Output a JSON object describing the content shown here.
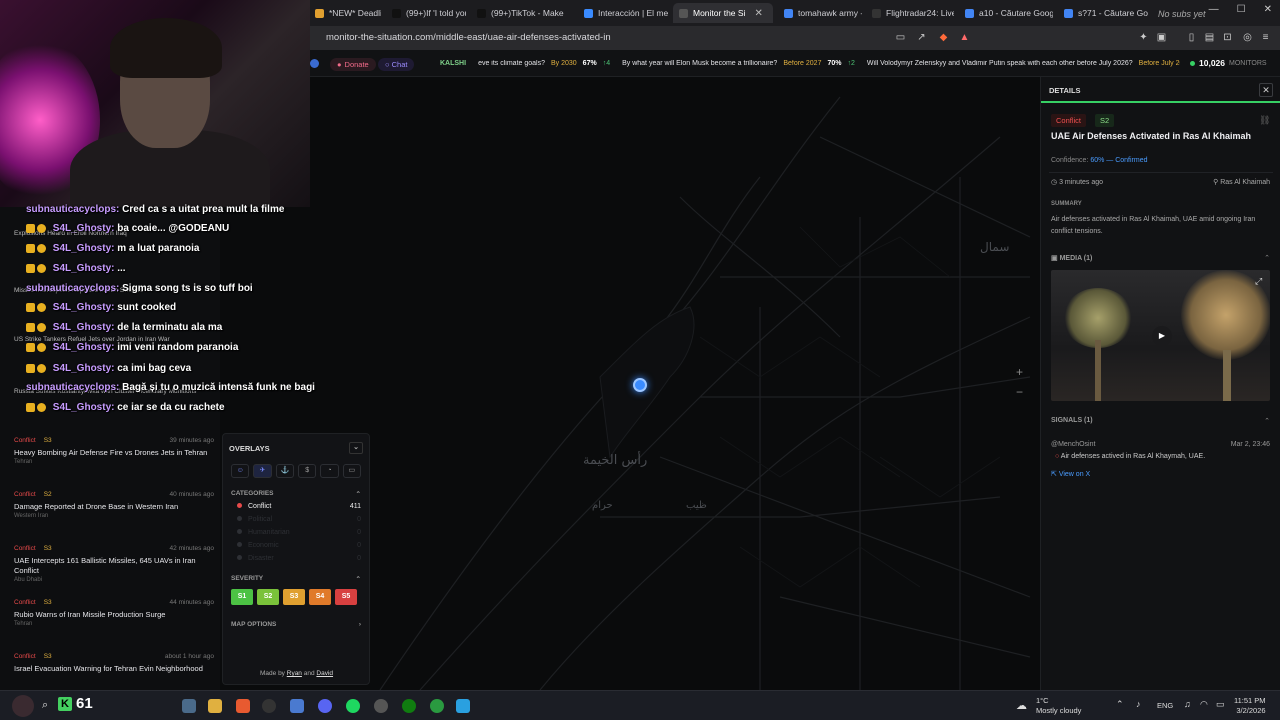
{
  "browser": {
    "tabs": [
      {
        "label": "*NEW* Deadline M",
        "fav": "#e0a030"
      },
      {
        "label": "(99+)If 'I told you s",
        "fav": "#111111"
      },
      {
        "label": "(99+)TikTok - Make",
        "fav": "#111111"
      },
      {
        "label": "Interacción | El mej",
        "fav": "#3a8bff"
      },
      {
        "label": "Monitor the Si",
        "fav": "#555555",
        "active": true
      },
      {
        "label": "tomahawk army - C",
        "fav": "#4285f4"
      },
      {
        "label": "Flightradar24: Live",
        "fav": "#333333"
      },
      {
        "label": "a10 - Căutare Goog",
        "fav": "#4285f4"
      },
      {
        "label": "s?71 - Căutare Goo",
        "fav": "#4285f4"
      }
    ],
    "tab_close": "✕",
    "corner_note": "No subs yet",
    "url": "monitor-the-situation.com/middle-east/uae-air-defenses-activated-in"
  },
  "sitebar": {
    "donate": "Donate",
    "chat": "Chat",
    "ticker": [
      {
        "src": "KALSHI",
        "q": "",
        "yr": "",
        "pct": "",
        "delta": ""
      },
      {
        "src": "",
        "q": "eve its climate goals?",
        "yr": "By 2030",
        "pct": "67%",
        "delta": "↑4"
      },
      {
        "src": "",
        "q": "By what year will Elon Musk become a trillionaire?",
        "yr": "Before 2027",
        "pct": "70%",
        "delta": "↑2"
      },
      {
        "src": "",
        "q": "Will Volodymyr Zelenskyy and Vladimir Putin speak with each other before July 2026?",
        "yr": "Before July 2026",
        "pct": "17%",
        "delta": "↑3"
      }
    ],
    "monitors_count": "10,026",
    "monitors_label": "MONITORS"
  },
  "map": {
    "labels": [
      "سمال",
      "رأس الخيمة",
      "حرام",
      "ظيب"
    ]
  },
  "chat_overlay": [
    {
      "user": "subnauticacyclops:",
      "msg": "Cred ca s a uitat prea mult la filme",
      "badges": false
    },
    {
      "user": "S4L_Ghosty:",
      "msg": "ba coaie... @GODEANU",
      "badges": true
    },
    {
      "user": "S4L_Ghosty:",
      "msg": "m a luat paranoia",
      "badges": true
    },
    {
      "user": "S4L_Ghosty:",
      "msg": "...",
      "badges": true
    },
    {
      "user": "subnauticacyclops:",
      "msg": "Sigma song ts is so tuff boi",
      "badges": false
    },
    {
      "user": "S4L_Ghosty:",
      "msg": "sunt cooked",
      "badges": true
    },
    {
      "user": "S4L_Ghosty:",
      "msg": "de la terminatu ala ma",
      "badges": true
    },
    {
      "user": "S4L_Ghosty:",
      "msg": "imi veni random paranoia",
      "badges": true
    },
    {
      "user": "S4L_Ghosty:",
      "msg": "ca imi bag ceva",
      "badges": true
    },
    {
      "user": "subnauticacyclops:",
      "msg": "Bagă și tu o muzică intensă funk ne bagi",
      "badges": false
    },
    {
      "user": "S4L_Ghosty:",
      "msg": "ce iar se da cu rachete",
      "badges": true
    }
  ],
  "news_partial": [
    "Explosions Heard in Erbil Northern Iraq",
    "Missile Interception Reported in Iran Sweeps",
    "US Strike Tankers Refuel Jets over Jordan in Iran War",
    "Russia Strikes Kostiantynivka with Cluster Incendiary Munitions"
  ],
  "news": [
    {
      "tag": "Conflict",
      "sev": "S3",
      "time": "39 minutes ago",
      "title": "Heavy Bombing Air Defense Fire vs Drones Jets in Tehran",
      "loc": "Tehran"
    },
    {
      "tag": "Conflict",
      "sev": "S2",
      "time": "40 minutes ago",
      "title": "Damage Reported at Drone Base in Western Iran",
      "loc": "Western Iran"
    },
    {
      "tag": "Conflict",
      "sev": "S3",
      "time": "42 minutes ago",
      "title": "UAE Intercepts 161 Ballistic Missiles, 645 UAVs in Iran Conflict",
      "loc": "Abu Dhabi"
    },
    {
      "tag": "Conflict",
      "sev": "S3",
      "time": "44 minutes ago",
      "title": "Rubio Warns of Iran Missile Production Surge",
      "loc": "Tehran"
    },
    {
      "tag": "Conflict",
      "sev": "S3",
      "time": "about 1 hour ago",
      "title": "Israel Evacuation Warning for Tehran Evin Neighborhood",
      "loc": ""
    }
  ],
  "overlays": {
    "title": "OVERLAYS",
    "categories_label": "CATEGORIES",
    "categories": [
      {
        "name": "Conflict",
        "count": "411",
        "active": true
      },
      {
        "name": "Political",
        "count": "0",
        "active": false
      },
      {
        "name": "Humanitarian",
        "count": "0",
        "active": false
      },
      {
        "name": "Economic",
        "count": "0",
        "active": false
      },
      {
        "name": "Disaster",
        "count": "0",
        "active": false
      }
    ],
    "severity_label": "SEVERITY",
    "severity": [
      {
        "label": "S1",
        "color": "#4cc244"
      },
      {
        "label": "S2",
        "color": "#7ac23a"
      },
      {
        "label": "S3",
        "color": "#e0a030"
      },
      {
        "label": "S4",
        "color": "#e07a2a"
      },
      {
        "label": "S5",
        "color": "#d84040"
      }
    ],
    "map_options_label": "MAP OPTIONS"
  },
  "madeby": {
    "prefix": "Made by",
    "a": "Ryan",
    "and": "and",
    "b": "David"
  },
  "details": {
    "header": "DETAILS",
    "category": "Conflict",
    "severity": "S2",
    "headline": "UAE Air Defenses Activated in Ras Al Khaimah",
    "confidence_label": "Confidence:",
    "confidence_value": "60% — Confirmed",
    "time": "3 minutes ago",
    "location": "Ras Al Khaimah",
    "summary_label": "SUMMARY",
    "summary": "Air defenses activated in Ras Al Khaimah, UAE amid ongoing Iran conflict tensions.",
    "media_label": "MEDIA (1)",
    "signals_label": "SIGNALS (1)",
    "signal_user": "@MenchOsint",
    "signal_date": "Mar 2, 23:46",
    "signal_text": "Air defenses actived in Ras Al Khaymah, UAE.",
    "signal_link": "View on X"
  },
  "taskbar": {
    "score": "61",
    "temp": "1°C",
    "weather": "Mostly cloudy",
    "lang": "ENG",
    "time": "11:51 PM",
    "date": "3/2/2026"
  }
}
